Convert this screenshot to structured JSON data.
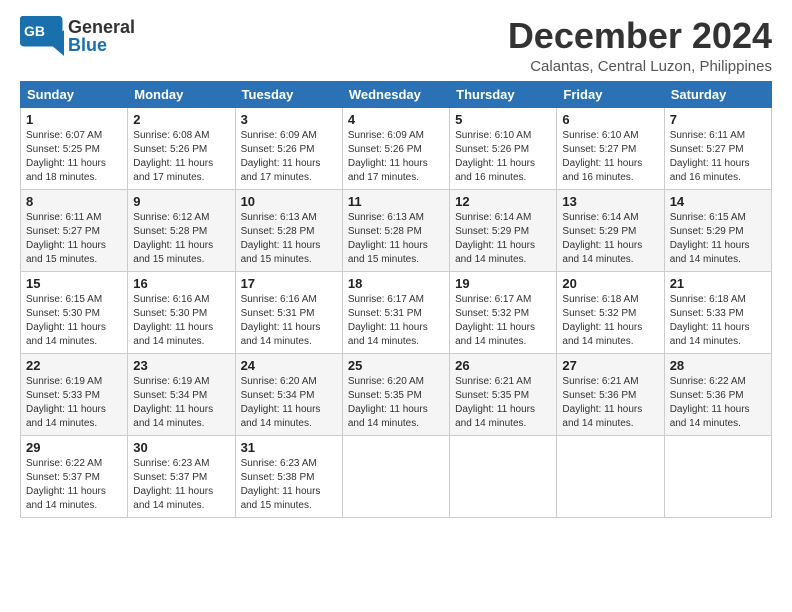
{
  "header": {
    "logo_general": "General",
    "logo_blue": "Blue",
    "month_title": "December 2024",
    "location": "Calantas, Central Luzon, Philippines"
  },
  "weekdays": [
    "Sunday",
    "Monday",
    "Tuesday",
    "Wednesday",
    "Thursday",
    "Friday",
    "Saturday"
  ],
  "weeks": [
    [
      {
        "day": "1",
        "sunrise": "6:07 AM",
        "sunset": "5:25 PM",
        "daylight": "11 hours and 18 minutes."
      },
      {
        "day": "2",
        "sunrise": "6:08 AM",
        "sunset": "5:26 PM",
        "daylight": "11 hours and 17 minutes."
      },
      {
        "day": "3",
        "sunrise": "6:09 AM",
        "sunset": "5:26 PM",
        "daylight": "11 hours and 17 minutes."
      },
      {
        "day": "4",
        "sunrise": "6:09 AM",
        "sunset": "5:26 PM",
        "daylight": "11 hours and 17 minutes."
      },
      {
        "day": "5",
        "sunrise": "6:10 AM",
        "sunset": "5:26 PM",
        "daylight": "11 hours and 16 minutes."
      },
      {
        "day": "6",
        "sunrise": "6:10 AM",
        "sunset": "5:27 PM",
        "daylight": "11 hours and 16 minutes."
      },
      {
        "day": "7",
        "sunrise": "6:11 AM",
        "sunset": "5:27 PM",
        "daylight": "11 hours and 16 minutes."
      }
    ],
    [
      {
        "day": "8",
        "sunrise": "6:11 AM",
        "sunset": "5:27 PM",
        "daylight": "11 hours and 15 minutes."
      },
      {
        "day": "9",
        "sunrise": "6:12 AM",
        "sunset": "5:28 PM",
        "daylight": "11 hours and 15 minutes."
      },
      {
        "day": "10",
        "sunrise": "6:13 AM",
        "sunset": "5:28 PM",
        "daylight": "11 hours and 15 minutes."
      },
      {
        "day": "11",
        "sunrise": "6:13 AM",
        "sunset": "5:28 PM",
        "daylight": "11 hours and 15 minutes."
      },
      {
        "day": "12",
        "sunrise": "6:14 AM",
        "sunset": "5:29 PM",
        "daylight": "11 hours and 14 minutes."
      },
      {
        "day": "13",
        "sunrise": "6:14 AM",
        "sunset": "5:29 PM",
        "daylight": "11 hours and 14 minutes."
      },
      {
        "day": "14",
        "sunrise": "6:15 AM",
        "sunset": "5:29 PM",
        "daylight": "11 hours and 14 minutes."
      }
    ],
    [
      {
        "day": "15",
        "sunrise": "6:15 AM",
        "sunset": "5:30 PM",
        "daylight": "11 hours and 14 minutes."
      },
      {
        "day": "16",
        "sunrise": "6:16 AM",
        "sunset": "5:30 PM",
        "daylight": "11 hours and 14 minutes."
      },
      {
        "day": "17",
        "sunrise": "6:16 AM",
        "sunset": "5:31 PM",
        "daylight": "11 hours and 14 minutes."
      },
      {
        "day": "18",
        "sunrise": "6:17 AM",
        "sunset": "5:31 PM",
        "daylight": "11 hours and 14 minutes."
      },
      {
        "day": "19",
        "sunrise": "6:17 AM",
        "sunset": "5:32 PM",
        "daylight": "11 hours and 14 minutes."
      },
      {
        "day": "20",
        "sunrise": "6:18 AM",
        "sunset": "5:32 PM",
        "daylight": "11 hours and 14 minutes."
      },
      {
        "day": "21",
        "sunrise": "6:18 AM",
        "sunset": "5:33 PM",
        "daylight": "11 hours and 14 minutes."
      }
    ],
    [
      {
        "day": "22",
        "sunrise": "6:19 AM",
        "sunset": "5:33 PM",
        "daylight": "11 hours and 14 minutes."
      },
      {
        "day": "23",
        "sunrise": "6:19 AM",
        "sunset": "5:34 PM",
        "daylight": "11 hours and 14 minutes."
      },
      {
        "day": "24",
        "sunrise": "6:20 AM",
        "sunset": "5:34 PM",
        "daylight": "11 hours and 14 minutes."
      },
      {
        "day": "25",
        "sunrise": "6:20 AM",
        "sunset": "5:35 PM",
        "daylight": "11 hours and 14 minutes."
      },
      {
        "day": "26",
        "sunrise": "6:21 AM",
        "sunset": "5:35 PM",
        "daylight": "11 hours and 14 minutes."
      },
      {
        "day": "27",
        "sunrise": "6:21 AM",
        "sunset": "5:36 PM",
        "daylight": "11 hours and 14 minutes."
      },
      {
        "day": "28",
        "sunrise": "6:22 AM",
        "sunset": "5:36 PM",
        "daylight": "11 hours and 14 minutes."
      }
    ],
    [
      {
        "day": "29",
        "sunrise": "6:22 AM",
        "sunset": "5:37 PM",
        "daylight": "11 hours and 14 minutes."
      },
      {
        "day": "30",
        "sunrise": "6:23 AM",
        "sunset": "5:37 PM",
        "daylight": "11 hours and 14 minutes."
      },
      {
        "day": "31",
        "sunrise": "6:23 AM",
        "sunset": "5:38 PM",
        "daylight": "11 hours and 15 minutes."
      },
      null,
      null,
      null,
      null
    ]
  ]
}
